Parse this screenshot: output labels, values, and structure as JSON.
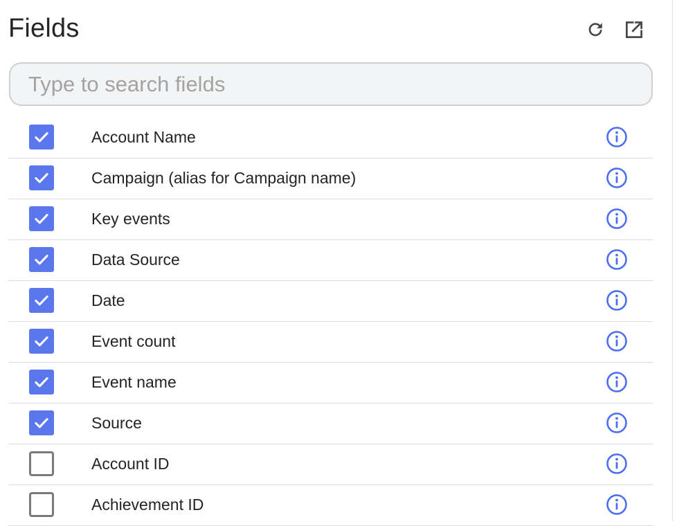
{
  "panel": {
    "title": "Fields",
    "refresh_icon": "refresh-icon",
    "open_external_icon": "open-in-new-icon"
  },
  "search": {
    "placeholder": "Type to search fields",
    "value": ""
  },
  "colors": {
    "accent": "#5a77ee",
    "info": "#4c6ef0",
    "checkbox_border": "#7a7a7a",
    "divider": "#dcdcdc"
  },
  "fields": [
    {
      "label": "Account Name",
      "checked": true,
      "info_icon": "info-icon"
    },
    {
      "label": "Campaign (alias for Campaign name)",
      "checked": true,
      "info_icon": "info-icon"
    },
    {
      "label": "Key events",
      "checked": true,
      "info_icon": "info-icon"
    },
    {
      "label": "Data Source",
      "checked": true,
      "info_icon": "info-icon"
    },
    {
      "label": "Date",
      "checked": true,
      "info_icon": "info-icon"
    },
    {
      "label": "Event count",
      "checked": true,
      "info_icon": "info-icon"
    },
    {
      "label": "Event name",
      "checked": true,
      "info_icon": "info-icon"
    },
    {
      "label": "Source",
      "checked": true,
      "info_icon": "info-icon"
    },
    {
      "label": "Account ID",
      "checked": false,
      "info_icon": "info-icon"
    },
    {
      "label": "Achievement ID",
      "checked": false,
      "info_icon": "info-icon"
    }
  ]
}
